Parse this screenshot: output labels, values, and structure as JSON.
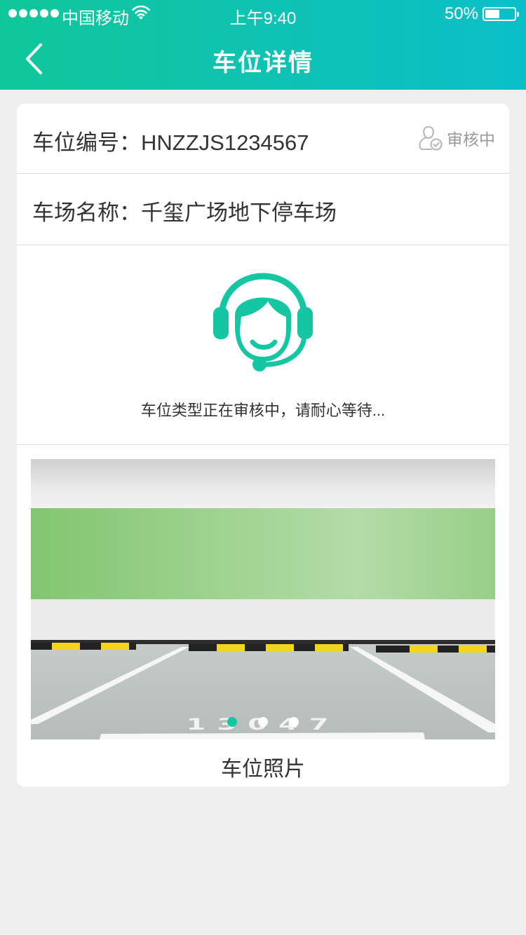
{
  "status_bar": {
    "carrier": "中国移动",
    "time": "上午9:40",
    "battery": "50%",
    "battery_level": 0.5,
    "signal_icon": "signal-dots-icon",
    "wifi_icon": "wifi-icon"
  },
  "nav": {
    "title": "车位详情",
    "back_icon": "chevron-left-icon"
  },
  "detail": {
    "space_number": "车位编号：HNZZJS1234567",
    "review_status": "审核中",
    "lot_name": "车场名称：千玺广场地下停车场"
  },
  "review": {
    "icon": "customer-service-icon",
    "message": "车位类型正在审核中，请耐心等待..."
  },
  "photos": {
    "caption": "车位照片",
    "image_number": "13047",
    "count": 3,
    "active_index": 0
  },
  "colors": {
    "accent": "#14c6a2",
    "header_start": "#10c79a",
    "header_end": "#0bbfc8"
  }
}
